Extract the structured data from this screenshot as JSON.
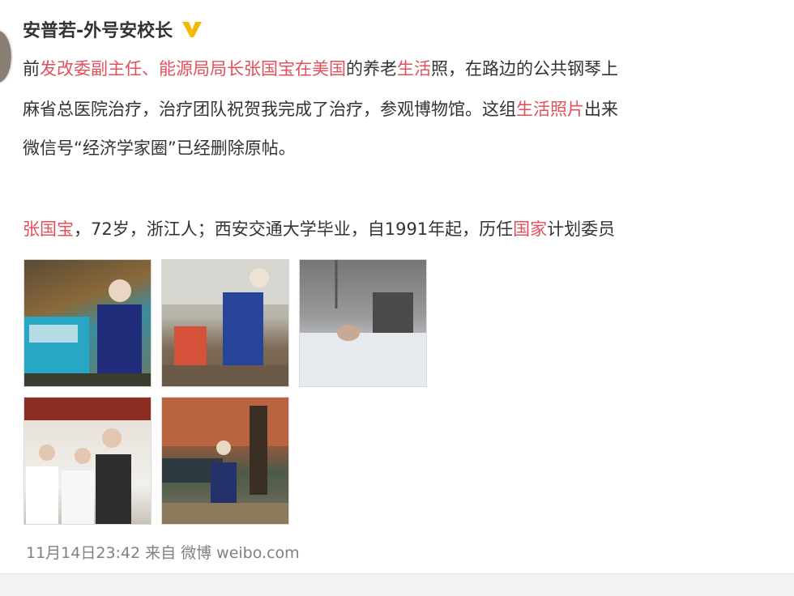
{
  "post": {
    "author": "安普若-外号安校长",
    "verified_icon": "verified-v-icon",
    "lines": [
      [
        {
          "text": "前",
          "hl": false
        },
        {
          "text": "发改委副主任、能源局局长张国宝在美国",
          "hl": true
        },
        {
          "text": "的养老",
          "hl": false
        },
        {
          "text": "生活",
          "hl": true
        },
        {
          "text": "照，在路边的公共钢琴上",
          "hl": false
        }
      ],
      [
        {
          "text": "麻省总医院治疗，治疗团队祝贺我完成了治疗，参观博物馆。这组",
          "hl": false
        },
        {
          "text": "生活照片",
          "hl": true
        },
        {
          "text": "出来",
          "hl": false
        }
      ],
      [
        {
          "text": "微信号“经济学家圈”已经删除原帖。",
          "hl": false
        }
      ],
      [
        {
          "text": "张国宝",
          "hl": true
        },
        {
          "text": "，72岁，浙江人；西安交通大学毕业，自1991年起，历任",
          "hl": false
        },
        {
          "text": "国家",
          "hl": true
        },
        {
          "text": "计划委员",
          "hl": false
        }
      ]
    ],
    "images": [
      {
        "alt": "photo-piano"
      },
      {
        "alt": "photo-bench"
      },
      {
        "alt": "photo-hospital-bed"
      },
      {
        "alt": "photo-medical-team"
      },
      {
        "alt": "photo-autumn-street"
      }
    ],
    "timestamp": "11月14日23:42",
    "source_prefix": "来自",
    "source": "微博 weibo.com"
  },
  "colors": {
    "highlight": "#e2505a",
    "text": "#333333",
    "meta": "#808080",
    "verified": "#f5b800"
  }
}
